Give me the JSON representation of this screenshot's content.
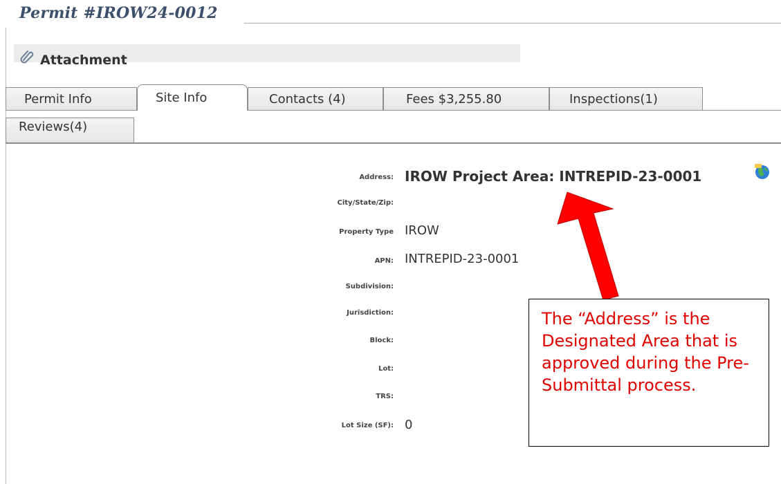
{
  "header": {
    "permit_title": "Permit #IROW24-0012"
  },
  "attachment": {
    "label": "Attachment",
    "icon": "paperclip-icon"
  },
  "tabs": [
    {
      "label": "Permit Info",
      "active": false
    },
    {
      "label": "Site Info",
      "active": true
    },
    {
      "label": "Contacts (4)",
      "active": false
    },
    {
      "label": "Fees $3,255.80",
      "active": false
    },
    {
      "label": "Inspections(1)",
      "active": false
    },
    {
      "label": "Reviews(4)",
      "active": false
    }
  ],
  "site_info": {
    "address_label": "Address:",
    "address_value": "IROW Project Area: INTREPID-23-0001",
    "city_label": "City/State/Zip:",
    "property_type_label": "Property Type",
    "property_type_value": "IROW",
    "apn_label": "APN:",
    "apn_value": "INTREPID-23-0001",
    "subdivision_label": "Subdivision:",
    "jurisdiction_label": "Jurisdiction:",
    "block_label": "Block:",
    "lot_label": "Lot:",
    "trs_label": "TRS:",
    "lot_size_label": "Lot Size (SF):",
    "lot_size_value": "0"
  },
  "annotation": {
    "text": "The “Address” is the Designated Area that is approved during the Pre-Submittal process.",
    "color": "#e00000"
  }
}
